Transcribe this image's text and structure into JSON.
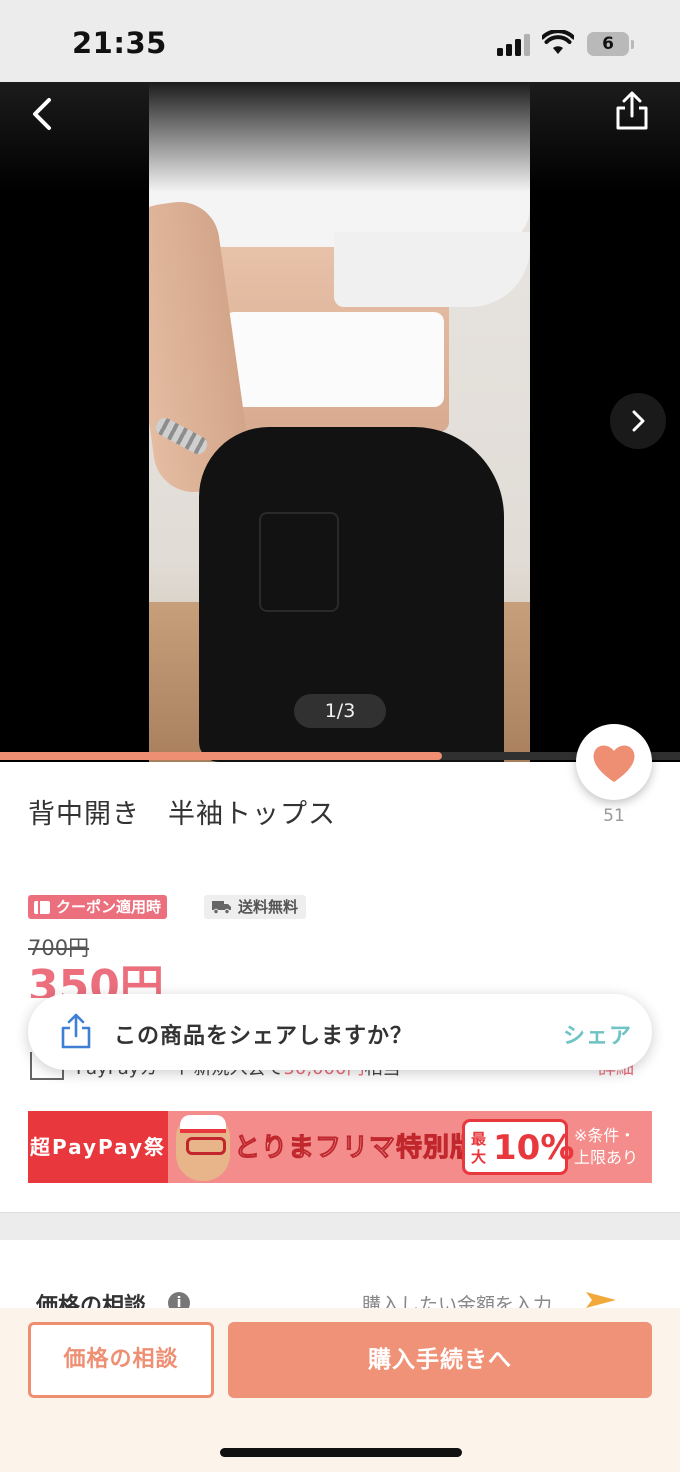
{
  "status_bar": {
    "time": "21:35",
    "battery": "6"
  },
  "image_viewer": {
    "page_indicator": "1/3",
    "progress": 0.65
  },
  "product": {
    "title": "背中開き　半袖トップス",
    "like_count": "51",
    "tags": {
      "coupon": "クーポン適用時",
      "shipping": "送料無料"
    },
    "original_price": "700円",
    "price": "350円"
  },
  "paypay_row": {
    "text_prefix": "PayPayカード新規入会で",
    "text_highlight": "50,000円",
    "text_suffix": "相当",
    "detail": "詳細"
  },
  "share_toast": {
    "message": "この商品をシェアしますか？",
    "action": "シェア"
  },
  "banner": {
    "left_text": "超PayPay祭",
    "title": "とりまフリマ特別版",
    "max_label": "最大",
    "discount": "10%",
    "note_line1": "※条件・",
    "note_line2": "上限あり"
  },
  "negotiation": {
    "label": "価格の相談",
    "hint": "購入したい金額を入力"
  },
  "actions": {
    "negotiate": "価格の相談",
    "purchase": "購入手続きへ"
  },
  "colors": {
    "accent": "#ee8f74",
    "coupon": "#ec6f7e",
    "share": "#6ec3c3",
    "banner_red": "#e8383d"
  },
  "icons": [
    "back-icon",
    "share-icon",
    "chevron-right-icon",
    "heart-icon",
    "coupon-icon",
    "truck-icon",
    "upload-icon",
    "info-icon",
    "arrow-icon"
  ]
}
